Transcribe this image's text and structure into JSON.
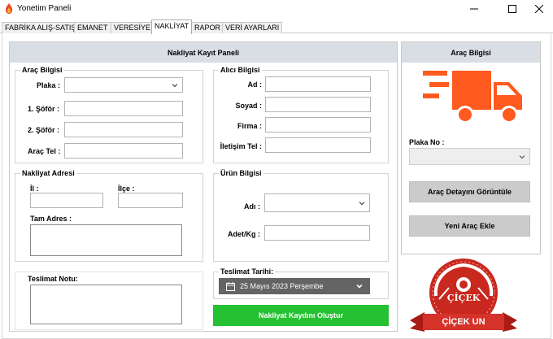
{
  "window": {
    "title": "Yonetim Paneli"
  },
  "tabs": [
    {
      "label": "FABRİKA ALIŞ-SATIŞ",
      "active": false
    },
    {
      "label": "EMANET",
      "active": false
    },
    {
      "label": "VERESİYE",
      "active": false
    },
    {
      "label": "NAKLİYAT",
      "active": true
    },
    {
      "label": "RAPOR",
      "active": false
    },
    {
      "label": "VERİ AYARLARI",
      "active": false
    }
  ],
  "main_panel": {
    "title": "Nakliyat Kayıt Paneli"
  },
  "vehicle_group": {
    "title": "Araç Bilgisi",
    "plate_label": "Plaka :",
    "driver1_label": "1. Şöför :",
    "driver2_label": "2. Şöför :",
    "phone_label": "Araç Tel :"
  },
  "recipient_group": {
    "title": "Alıcı Bilgisi",
    "name_label": "Ad :",
    "surname_label": "Soyad :",
    "company_label": "Firma :",
    "contact_label": "İletişim Tel :"
  },
  "address_group": {
    "title": "Nakliyat Adresi",
    "city_label": "İl :",
    "district_label": "İlçe :",
    "full_address_label": "Tam Adres :"
  },
  "product_group": {
    "title": "Ürün Bilgisi",
    "name_label": "Adı :",
    "qty_label": "Adet/Kg :"
  },
  "delivery_note": {
    "label": "Teslimat Notu:"
  },
  "delivery_date": {
    "label": "Teslimat Tarihi:",
    "value": "25 Mayıs 2023 Perşembe"
  },
  "create_button": {
    "label": "Nakliyat Kaydını Oluştur"
  },
  "side_panel": {
    "title": "Araç Bilgisi",
    "plate_no_label": "Plaka No :",
    "details_button": "Araç Detayını Görüntüle",
    "new_vehicle_button": "Yeni Araç Ekle"
  },
  "logo": {
    "brand": "ÇİÇEK",
    "banner": "ÇİÇEK UN"
  },
  "colors": {
    "accent_orange": "#ff5a1f",
    "green_button": "#25c132",
    "panel_header": "#d9dee5",
    "logo_red": "#c8281e"
  }
}
